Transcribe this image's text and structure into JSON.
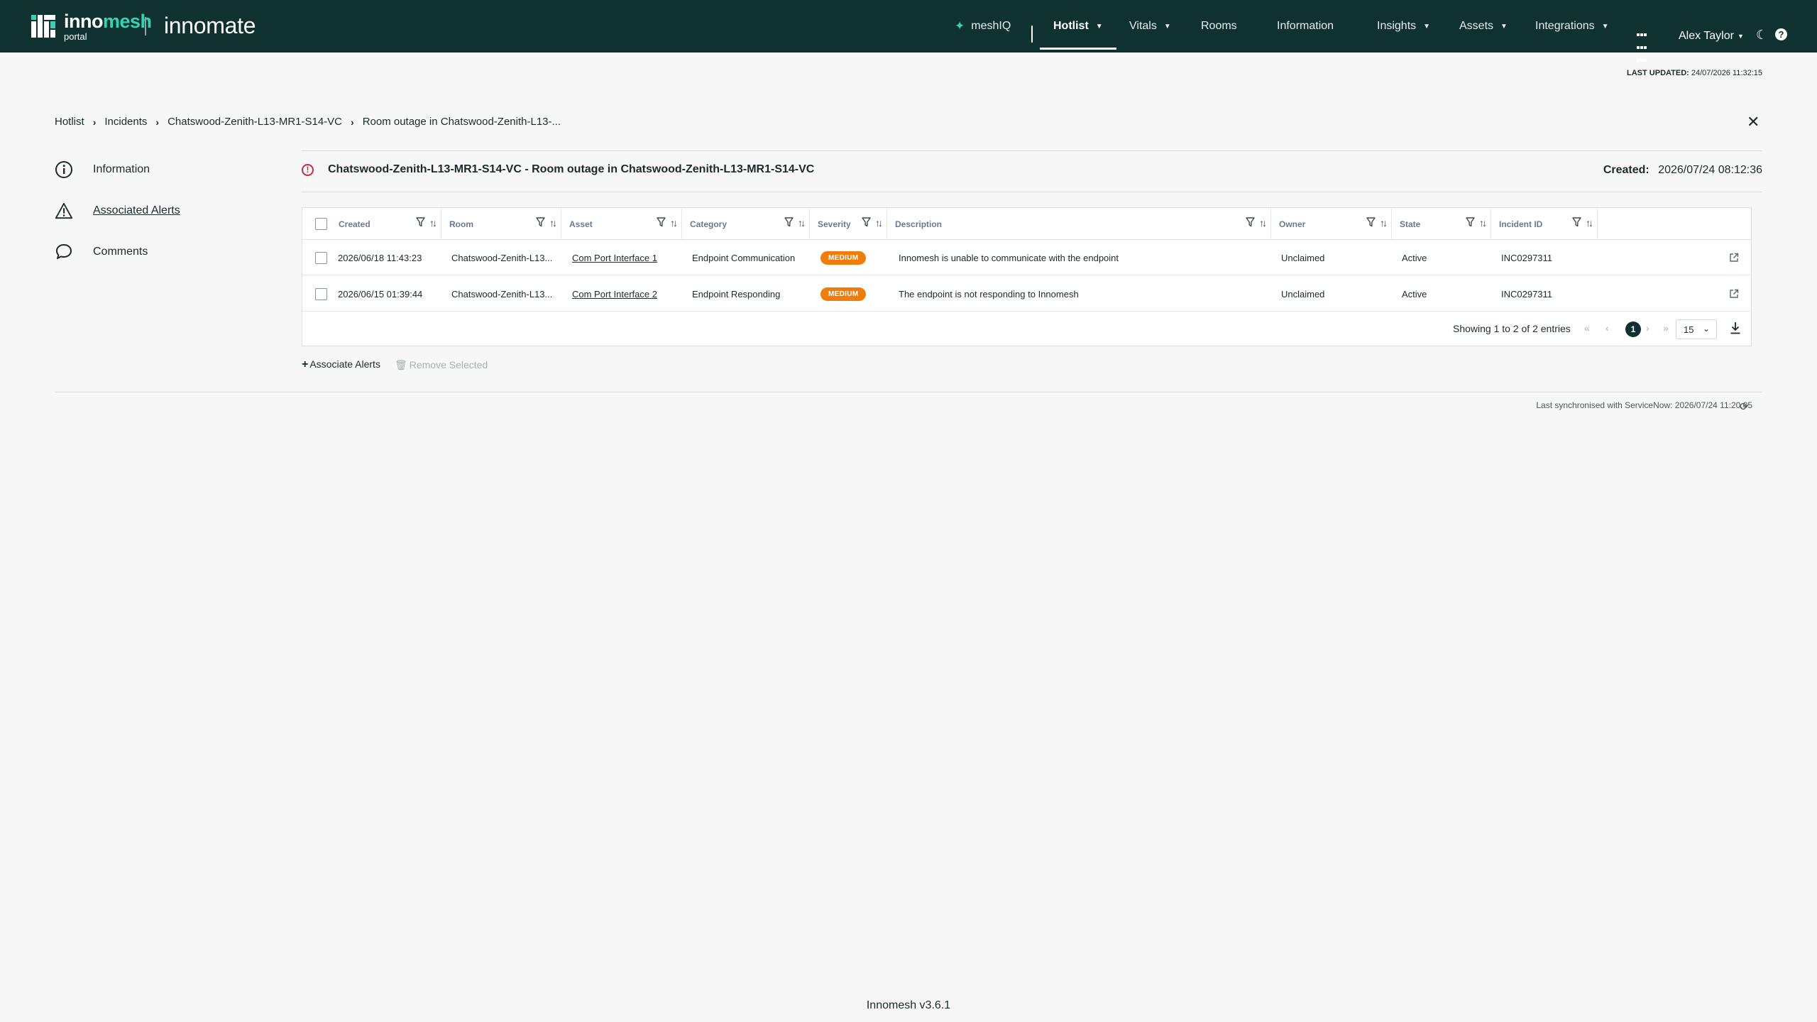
{
  "header": {
    "logo_brand_1": "inno",
    "logo_brand_2": "mesh",
    "logo_sub": "portal",
    "app_name": "innomate",
    "nav": {
      "meshiq": "meshIQ",
      "hotlist": "Hotlist",
      "vitals": "Vitals",
      "rooms": "Rooms",
      "information": "Information",
      "insights": "Insights",
      "assets": "Assets",
      "integrations": "Integrations"
    },
    "user_name": "Alex Taylor",
    "help_glyph": "?"
  },
  "last_updated": {
    "label": "LAST UPDATED:",
    "value": "24/07/2026 11:32:15"
  },
  "breadcrumb": [
    "Hotlist",
    "Incidents",
    "Chatswood-Zenith-L13-MR1-S14-VC",
    "Room outage in Chatswood-Zenith-L13-..."
  ],
  "side_menu": [
    {
      "label": "Information",
      "icon": "info-circle-icon"
    },
    {
      "label": "Associated Alerts",
      "icon": "warning-triangle-icon",
      "active": true
    },
    {
      "label": "Comments",
      "icon": "speech-bubble-icon"
    }
  ],
  "incident": {
    "title": "Chatswood-Zenith-L13-MR1-S14-VC - Room outage in Chatswood-Zenith-L13-MR1-S14-VC",
    "created_label": "Created:",
    "created_value": "2026/07/24 08:12:36"
  },
  "table": {
    "columns": [
      "Created",
      "Room",
      "Asset",
      "Category",
      "Severity",
      "Description",
      "Owner",
      "State",
      "Incident ID"
    ],
    "rows": [
      {
        "created": "2026/06/18 11:43:23",
        "room": "Chatswood-Zenith-L13...",
        "asset": "Com Port Interface 1",
        "category": "Endpoint Communication",
        "severity": "MEDIUM",
        "description": "Innomesh is unable to communicate with the endpoint",
        "owner": "Unclaimed",
        "state": "Active",
        "incident_id": "INC0297311"
      },
      {
        "created": "2026/06/15 01:39:44",
        "room": "Chatswood-Zenith-L13...",
        "asset": "Com Port Interface 2",
        "category": "Endpoint Responding",
        "severity": "MEDIUM",
        "description": "The endpoint is not responding to Innomesh",
        "owner": "Unclaimed",
        "state": "Active",
        "incident_id": "INC0297311"
      }
    ],
    "showing": "Showing 1 to 2 of 2 entries",
    "current_page": "1",
    "page_size": "15"
  },
  "actions": {
    "associate": "Associate Alerts",
    "remove": "Remove Selected"
  },
  "sync_text": "Last synchronised with ServiceNow: 2026/07/24 11:20:05",
  "version": "Innomesh v3.6.1",
  "colors": {
    "header_bg": "#0f3230",
    "accent": "#34d3b5",
    "severity_medium": "#ee7d0c",
    "error": "#d0283c"
  }
}
